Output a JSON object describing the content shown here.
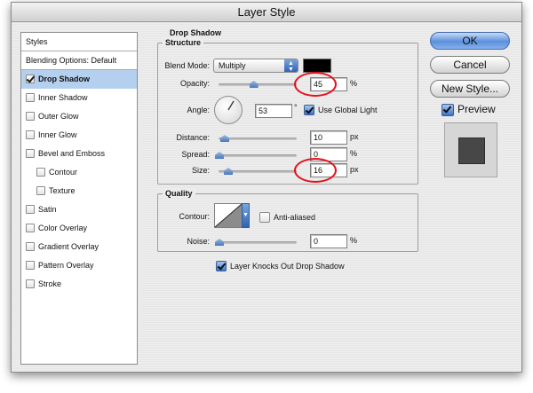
{
  "window": {
    "title": "Layer Style"
  },
  "sidebar": {
    "header": "Styles",
    "blending_options": "Blending Options: Default",
    "items": [
      {
        "label": "Drop Shadow",
        "checked": true,
        "selected": true,
        "indent": false
      },
      {
        "label": "Inner Shadow",
        "checked": false,
        "selected": false,
        "indent": false
      },
      {
        "label": "Outer Glow",
        "checked": false,
        "selected": false,
        "indent": false
      },
      {
        "label": "Inner Glow",
        "checked": false,
        "selected": false,
        "indent": false
      },
      {
        "label": "Bevel and Emboss",
        "checked": false,
        "selected": false,
        "indent": false
      },
      {
        "label": "Contour",
        "checked": false,
        "selected": false,
        "indent": true
      },
      {
        "label": "Texture",
        "checked": false,
        "selected": false,
        "indent": true
      },
      {
        "label": "Satin",
        "checked": false,
        "selected": false,
        "indent": false
      },
      {
        "label": "Color Overlay",
        "checked": false,
        "selected": false,
        "indent": false
      },
      {
        "label": "Gradient Overlay",
        "checked": false,
        "selected": false,
        "indent": false
      },
      {
        "label": "Pattern Overlay",
        "checked": false,
        "selected": false,
        "indent": false
      },
      {
        "label": "Stroke",
        "checked": false,
        "selected": false,
        "indent": false
      }
    ]
  },
  "panel": {
    "title": "Drop Shadow",
    "structure": {
      "title": "Structure",
      "blend_mode_label": "Blend Mode:",
      "blend_mode_value": "Multiply",
      "shadow_color": "#000000",
      "opacity_label": "Opacity:",
      "opacity_value": "45",
      "opacity_unit": "%",
      "opacity_fraction": 0.45,
      "angle_label": "Angle:",
      "angle_value": "53",
      "angle_unit": "°",
      "use_global_light_label": "Use Global Light",
      "use_global_light_checked": true,
      "distance_label": "Distance:",
      "distance_value": "10",
      "distance_unit": "px",
      "spread_label": "Spread:",
      "spread_value": "0",
      "spread_unit": "%",
      "size_label": "Size:",
      "size_value": "16",
      "size_unit": "px"
    },
    "quality": {
      "title": "Quality",
      "contour_label": "Contour:",
      "anti_aliased_label": "Anti-aliased",
      "anti_aliased_checked": false,
      "noise_label": "Noise:",
      "noise_value": "0",
      "noise_unit": "%"
    },
    "knockout_label": "Layer Knocks Out Drop Shadow",
    "knockout_checked": true
  },
  "buttons": {
    "ok": "OK",
    "cancel": "Cancel",
    "new_style": "New Style...",
    "preview_label": "Preview",
    "preview_checked": true
  },
  "colors": {
    "annotation_circle": "#e5101a",
    "selection": "#b5d0ee",
    "accent": "#3f6db4"
  }
}
